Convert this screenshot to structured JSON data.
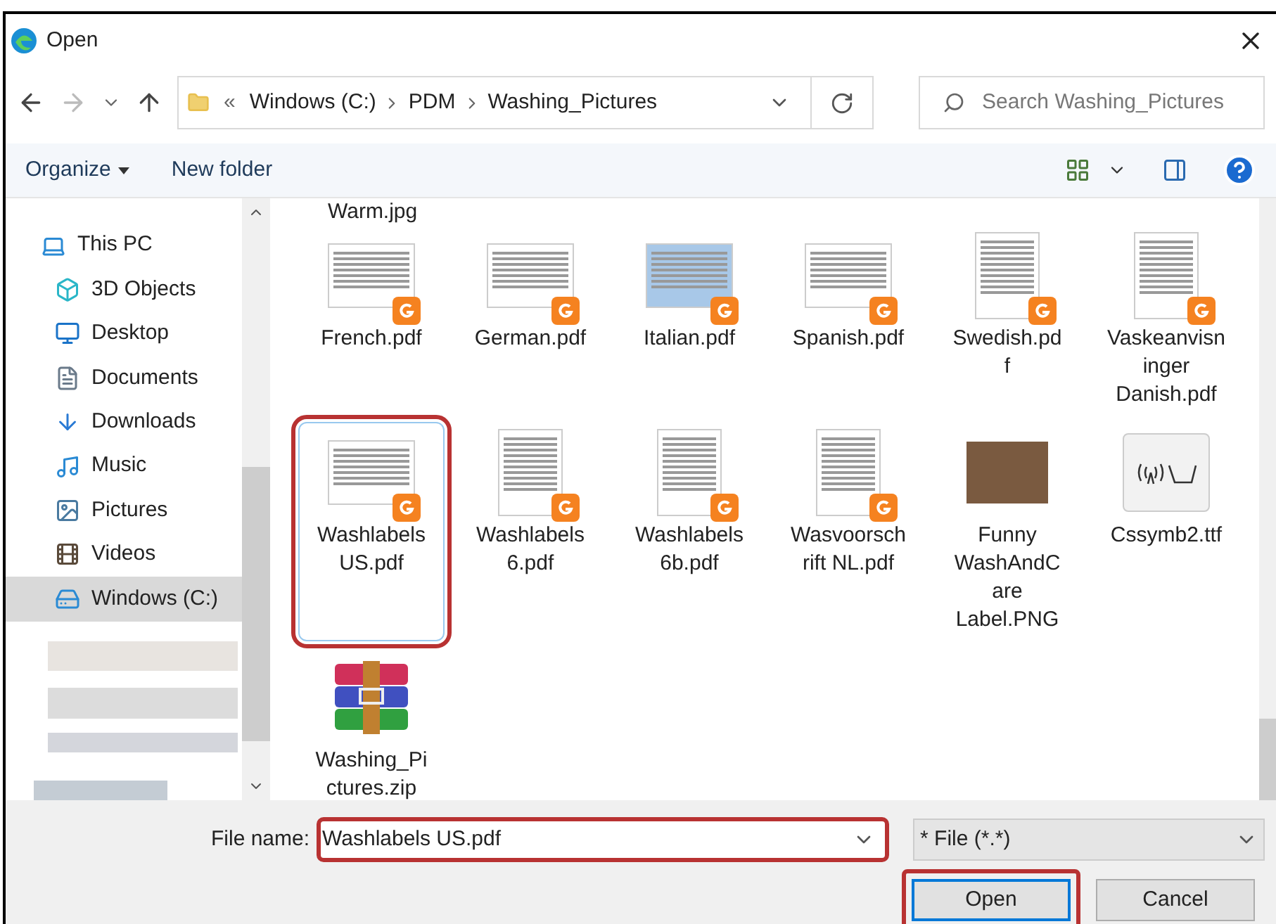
{
  "window": {
    "title": "Open"
  },
  "address_bar": {
    "overflow": "«",
    "path": [
      "Windows (C:)",
      "PDM",
      "Washing_Pictures"
    ]
  },
  "search": {
    "placeholder": "Search Washing_Pictures"
  },
  "toolbar": {
    "buttons": [
      "Organize",
      "New folder"
    ]
  },
  "sidebar": {
    "items": [
      {
        "label": "This PC",
        "selected": false
      },
      {
        "label": "3D Objects",
        "selected": false
      },
      {
        "label": "Desktop",
        "selected": false
      },
      {
        "label": "Documents",
        "selected": false
      },
      {
        "label": "Downloads",
        "selected": false
      },
      {
        "label": "Music",
        "selected": false
      },
      {
        "label": "Pictures",
        "selected": false
      },
      {
        "label": "Videos",
        "selected": false
      },
      {
        "label": "Windows (C:)",
        "selected": true
      }
    ]
  },
  "files": {
    "partial_label": "Warm.jpg",
    "items": [
      {
        "lines": [
          "French.pdf"
        ],
        "kind": "pdf",
        "selected": false,
        "highlighted": false
      },
      {
        "lines": [
          "German.pdf"
        ],
        "kind": "pdf",
        "selected": false,
        "highlighted": false
      },
      {
        "lines": [
          "Italian.pdf"
        ],
        "kind": "pdf-color",
        "selected": false,
        "highlighted": false
      },
      {
        "lines": [
          "Spanish.pdf"
        ],
        "kind": "pdf",
        "selected": false,
        "highlighted": false
      },
      {
        "lines": [
          "Swedish.pd",
          "f"
        ],
        "kind": "pdf-tall",
        "selected": false,
        "highlighted": false
      },
      {
        "lines": [
          "Vaskeanvisn",
          "inger",
          "Danish.pdf"
        ],
        "kind": "pdf-tall",
        "selected": false,
        "highlighted": false
      },
      {
        "lines": [
          "Washlabels",
          "US.pdf"
        ],
        "kind": "pdf",
        "selected": true,
        "highlighted": true
      },
      {
        "lines": [
          "Washlabels",
          "6.pdf"
        ],
        "kind": "pdf-tall",
        "selected": false,
        "highlighted": false
      },
      {
        "lines": [
          "Washlabels",
          "6b.pdf"
        ],
        "kind": "pdf-tall",
        "selected": false,
        "highlighted": false
      },
      {
        "lines": [
          "Wasvoorsch",
          "rift NL.pdf"
        ],
        "kind": "pdf-tall",
        "selected": false,
        "highlighted": false
      },
      {
        "lines": [
          "Funny",
          "WashAndC",
          "are",
          "Label.PNG"
        ],
        "kind": "photo",
        "selected": false,
        "highlighted": false
      },
      {
        "lines": [
          "Cssymb2.ttf"
        ],
        "kind": "font",
        "selected": false,
        "highlighted": false
      },
      {
        "lines": [
          "Washing_Pi",
          "ctures.zip"
        ],
        "kind": "zip",
        "selected": false,
        "highlighted": false
      }
    ]
  },
  "footer": {
    "file_name_label": "File name:",
    "file_name": "Washlabels US.pdf",
    "file_name_highlighted": true,
    "file_type": "* File (*.*)",
    "buttons": [
      {
        "label": "Open",
        "kind": "primary",
        "highlighted": true
      },
      {
        "label": "Cancel",
        "kind": "secondary",
        "highlighted": false
      }
    ]
  }
}
